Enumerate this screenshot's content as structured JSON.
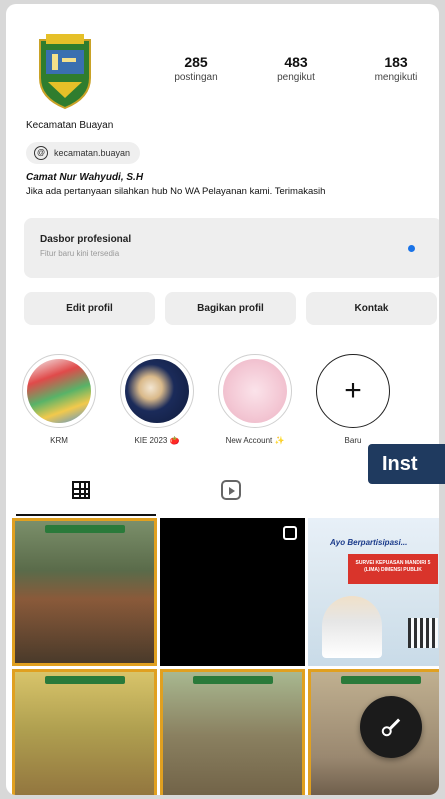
{
  "profile": {
    "stats": [
      {
        "value": "285",
        "label": "postingan"
      },
      {
        "value": "483",
        "label": "pengikut"
      },
      {
        "value": "183",
        "label": "mengikuti"
      }
    ],
    "display_name": "Kecamatan Buayan",
    "threads_handle": "kecamatan.buayan",
    "bio_name": "Camat Nur Wahyudi, S.H",
    "bio_text": "Jika ada pertanyaan silahkan hub No WA Pelayanan kami. Terimakasih"
  },
  "dashboard": {
    "title": "Dasbor profesional",
    "subtitle": "Fitur baru kini tersedia",
    "accent_color": "#1a73e8"
  },
  "actions": [
    "Edit profil",
    "Bagikan profil",
    "Kontak"
  ],
  "highlights": [
    {
      "label": "KRM"
    },
    {
      "label": "KIE 2023 🍅"
    },
    {
      "label": "New Account ✨"
    },
    {
      "label": "Baru"
    }
  ],
  "overlay_label": "Inst",
  "tabs": {
    "grid_icon": "grid-icon",
    "reels_icon": "reels-icon"
  },
  "grid_posts": [
    {
      "ribbon": true
    },
    {
      "reel": true
    },
    {
      "title": "Ayo Berpartisipasi...",
      "banner": "SURVEI KEPUASAN MANDIRI 5 (LIMA) DIMENSI PUBLIK"
    },
    {
      "ribbon": true
    },
    {
      "ribbon": true
    },
    {
      "ribbon": true
    }
  ],
  "fab_icon": "key-icon"
}
